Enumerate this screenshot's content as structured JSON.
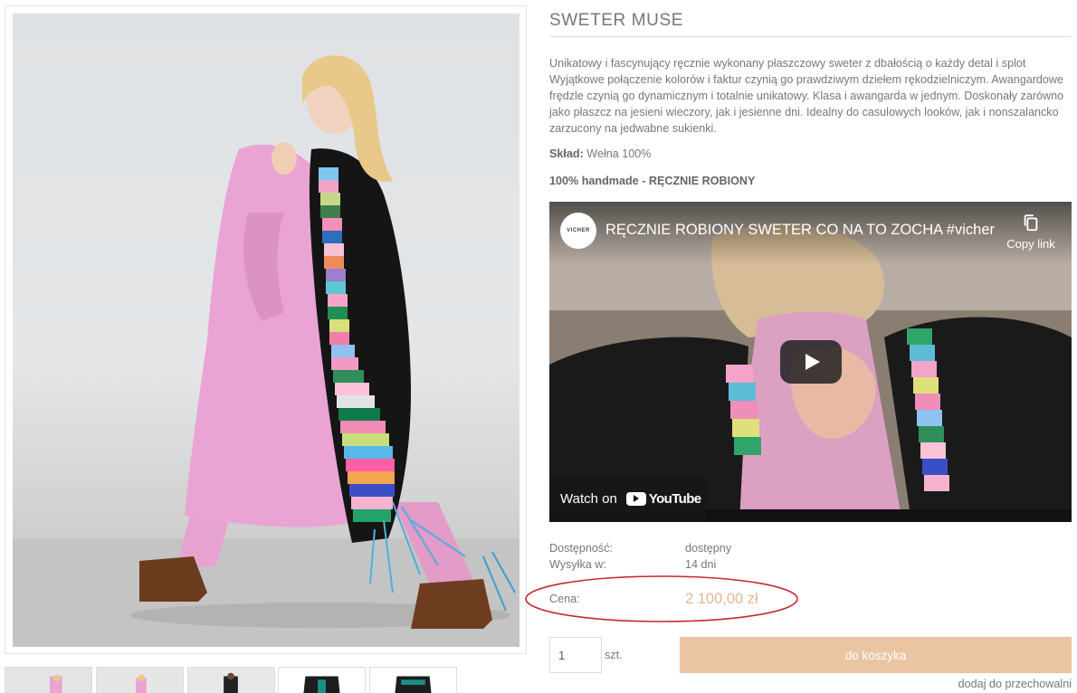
{
  "product": {
    "title": "SWETER MUSE",
    "description": "Unikatowy i fascynujący ręcznie wykonany płaszczowy sweter z dbałością o każdy detal i splot Wyjątkowe połączenie kolorów i faktur czynią go prawdziwym dziełem rękodzielniczym. Awangardowe frędzle czynią go dynamicznym i totalnie unikatowy. Klasa i awangarda w jednym. Doskonały zarówno jako płaszcz na jesieni wieczory, jak i jesienne dni. Idealny do casulowych looków, jak i nonszalancko zarzucony na jedwabne sukienki.",
    "composition_label": "Skład:",
    "composition_value": "Wełna 100%",
    "handmade_note": "100% handmade - RĘCZNIE ROBIONY"
  },
  "video": {
    "channel_logo_text": "VICHER",
    "title": "RĘCZNIE ROBIONY SWETER CO NA TO ZOCHA #vicher",
    "copy_link_label": "Copy link",
    "watch_on_label": "Watch on",
    "youtube_wordmark": "YouTube"
  },
  "meta": {
    "availability_label": "Dostępność:",
    "availability_value": "dostępny",
    "shipping_label": "Wysyłka w:",
    "shipping_value": "14 dni",
    "price_label": "Cena:",
    "price_value": "2 100,00 zł"
  },
  "cart": {
    "quantity_value": "1",
    "quantity_unit": "szt.",
    "add_to_cart_label": "do koszyka",
    "wishlist_label": "dodaj do przechowalni"
  },
  "thumbnails": {
    "count": 5
  },
  "colors": {
    "accent": "#ebc4a2",
    "price": "#e3b894",
    "annotation": "#c8282d"
  }
}
